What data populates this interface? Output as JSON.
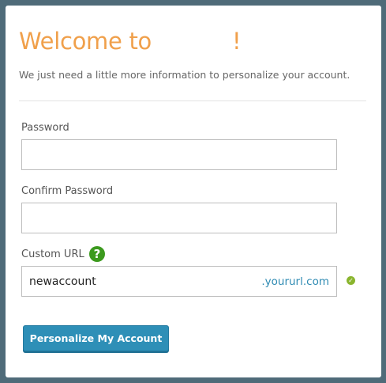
{
  "header": {
    "title_prefix": "Welcome to",
    "title_suffix": "!",
    "subtitle": "We just need a little more information to personalize your account."
  },
  "form": {
    "password": {
      "label": "Password",
      "value": ""
    },
    "confirm_password": {
      "label": "Confirm Password",
      "value": ""
    },
    "custom_url": {
      "label": "Custom URL",
      "help_icon": "?",
      "value": "newaccount",
      "suffix": ".yoururl.com",
      "valid_icon": "✓"
    },
    "submit_label": "Personalize My Account"
  },
  "colors": {
    "title": "#f0a04b",
    "button": "#2e8fb7",
    "help_icon": "#3c9a1e",
    "valid_icon": "#8ab52e",
    "url_suffix": "#2f8bb3"
  }
}
